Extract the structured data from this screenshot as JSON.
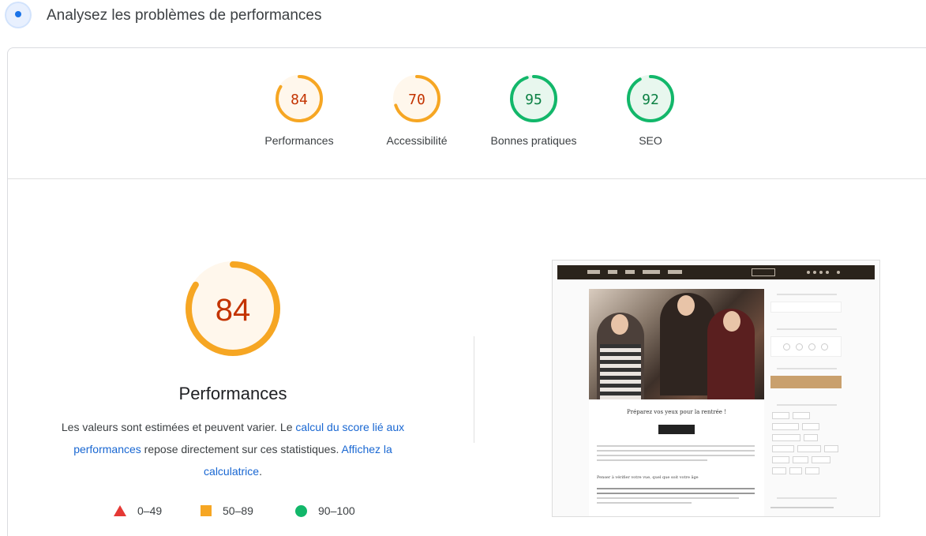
{
  "header": {
    "title": "Analysez les problèmes de performances",
    "icon": "lighthouse-icon"
  },
  "categories": [
    {
      "score": "84",
      "label": "Performances",
      "color": "#f6a623",
      "text_color": "#c33300",
      "fill": 0.84
    },
    {
      "score": "70",
      "label": "Accessibilité",
      "color": "#f6a623",
      "text_color": "#c33300",
      "fill": 0.7
    },
    {
      "score": "95",
      "label": "Bonnes pratiques",
      "color": "#12b76a",
      "text_color": "#0b8043",
      "fill": 0.95
    },
    {
      "score": "92",
      "label": "SEO",
      "color": "#12b76a",
      "text_color": "#0b8043",
      "fill": 0.92
    }
  ],
  "performance": {
    "score": "84",
    "fill": 0.84,
    "title": "Performances",
    "description_part1": "Les valeurs sont estimées et peuvent varier. Le ",
    "link1": "calcul du score lié aux performances",
    "description_part2": " repose directement sur ces statistiques. ",
    "link2": "Affichez la calculatrice",
    "description_part3": "."
  },
  "legend": [
    {
      "label": "0–49",
      "icon": "triangle-icon",
      "color": "#e53935"
    },
    {
      "label": "50–89",
      "icon": "square-icon",
      "color": "#f6a623"
    },
    {
      "label": "90–100",
      "icon": "circle-icon",
      "color": "#12b76a"
    }
  ],
  "thumbnail": {
    "headline": "Préparez vos yeux pour la rentrée !",
    "subheading": "Penser à vérifier votre vue, quel que soit votre âge"
  }
}
